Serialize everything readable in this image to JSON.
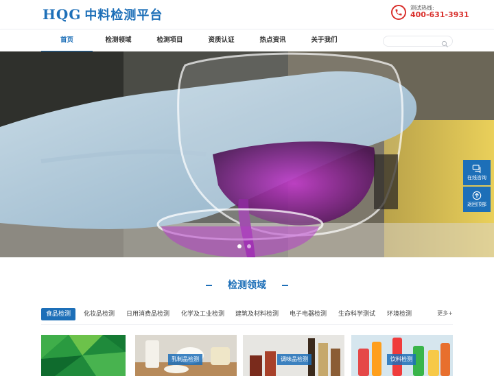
{
  "brand": {
    "latin": "HQG",
    "chinese": "中料检测平台"
  },
  "hotline": {
    "label": "测试热线:",
    "number": "400-631-3931"
  },
  "nav": {
    "items": [
      {
        "label": "首页",
        "active": true
      },
      {
        "label": "检测领域",
        "active": false
      },
      {
        "label": "检测项目",
        "active": false
      },
      {
        "label": "资质认证",
        "active": false
      },
      {
        "label": "热点资讯",
        "active": false
      },
      {
        "label": "关于我们",
        "active": false
      }
    ],
    "search_placeholder": ""
  },
  "hero": {
    "slides": 2,
    "active_slide": 0
  },
  "side": {
    "online_consult": "在线咨询",
    "back_to_top": "返回顶部"
  },
  "section": {
    "title": "检测领域"
  },
  "tabs": {
    "items": [
      {
        "label": "食品检测",
        "active": true
      },
      {
        "label": "化妆品检测",
        "active": false
      },
      {
        "label": "日用消费品检测",
        "active": false
      },
      {
        "label": "化学及工业检测",
        "active": false
      },
      {
        "label": "建筑及材料检测",
        "active": false
      },
      {
        "label": "电子电器检测",
        "active": false
      },
      {
        "label": "生命科学测试",
        "active": false
      },
      {
        "label": "环境检测",
        "active": false
      }
    ],
    "more": "更多+"
  },
  "cards": [
    {
      "label": ""
    },
    {
      "label": "乳制品检测"
    },
    {
      "label": "调味品检测"
    },
    {
      "label": "饮料检测"
    }
  ],
  "colors": {
    "brand_blue": "#1d6fb8",
    "hotline_red": "#d9302c"
  }
}
